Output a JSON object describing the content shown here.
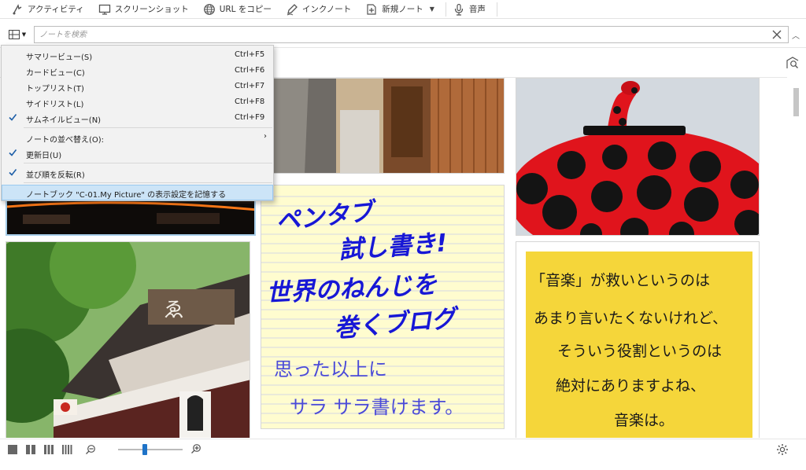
{
  "toolbar": {
    "items": [
      {
        "label": "アクティビティ",
        "icon": "activity-icon"
      },
      {
        "label": "スクリーンショット",
        "icon": "screenshot-icon"
      },
      {
        "label": "URL をコピー",
        "icon": "globe-icon"
      },
      {
        "label": "インクノート",
        "icon": "ink-pen-icon"
      },
      {
        "label": "新規ノート",
        "icon": "new-note-icon"
      },
      {
        "label": "音声",
        "icon": "microphone-icon"
      }
    ]
  },
  "search": {
    "placeholder": "ノートを検索"
  },
  "menu": {
    "items": [
      {
        "label": "サマリービュー(S)",
        "shortcut": "Ctrl+F5",
        "checked": false
      },
      {
        "label": "カードビュー(C)",
        "shortcut": "Ctrl+F6",
        "checked": false
      },
      {
        "label": "トップリスト(T)",
        "shortcut": "Ctrl+F7",
        "checked": false
      },
      {
        "label": "サイドリスト(L)",
        "shortcut": "Ctrl+F8",
        "checked": false
      },
      {
        "label": "サムネイルビュー(N)",
        "shortcut": "Ctrl+F9",
        "checked": true
      },
      {
        "label": "ノートの並べ替え(O):",
        "shortcut": "",
        "checked": false,
        "submenu": true
      },
      {
        "label": "更新日(U)",
        "shortcut": "",
        "checked": true
      },
      {
        "label": "並び順を反転(R)",
        "shortcut": "",
        "checked": true
      },
      {
        "label": "ノートブック \"C-01.My Picture\" の表示設定を記憶する",
        "shortcut": "",
        "checked": false,
        "highlighted": true
      }
    ]
  },
  "notes": {
    "ink_note_1": {
      "lines": [
        "ペンタブ",
        "試し書き!",
        "世界のねんじを",
        "巻くブログ",
        "思った以上に",
        "サラ サラ書けます。"
      ],
      "ink_color": "#1717d6",
      "pencil_color": "#4b4bd8"
    },
    "ink_note_2": {
      "lines": [
        "「音楽」が救いというのは",
        "あまり言いたくないけれど、",
        "そういう役割というのは",
        "絶対にありますよね、",
        "音楽は。"
      ],
      "paper_color": "#f5d63a"
    }
  },
  "colors": {
    "accent": "#1e73c8",
    "menu_highlight": "#cce4f7"
  },
  "zoom": {
    "level": 0.42
  }
}
